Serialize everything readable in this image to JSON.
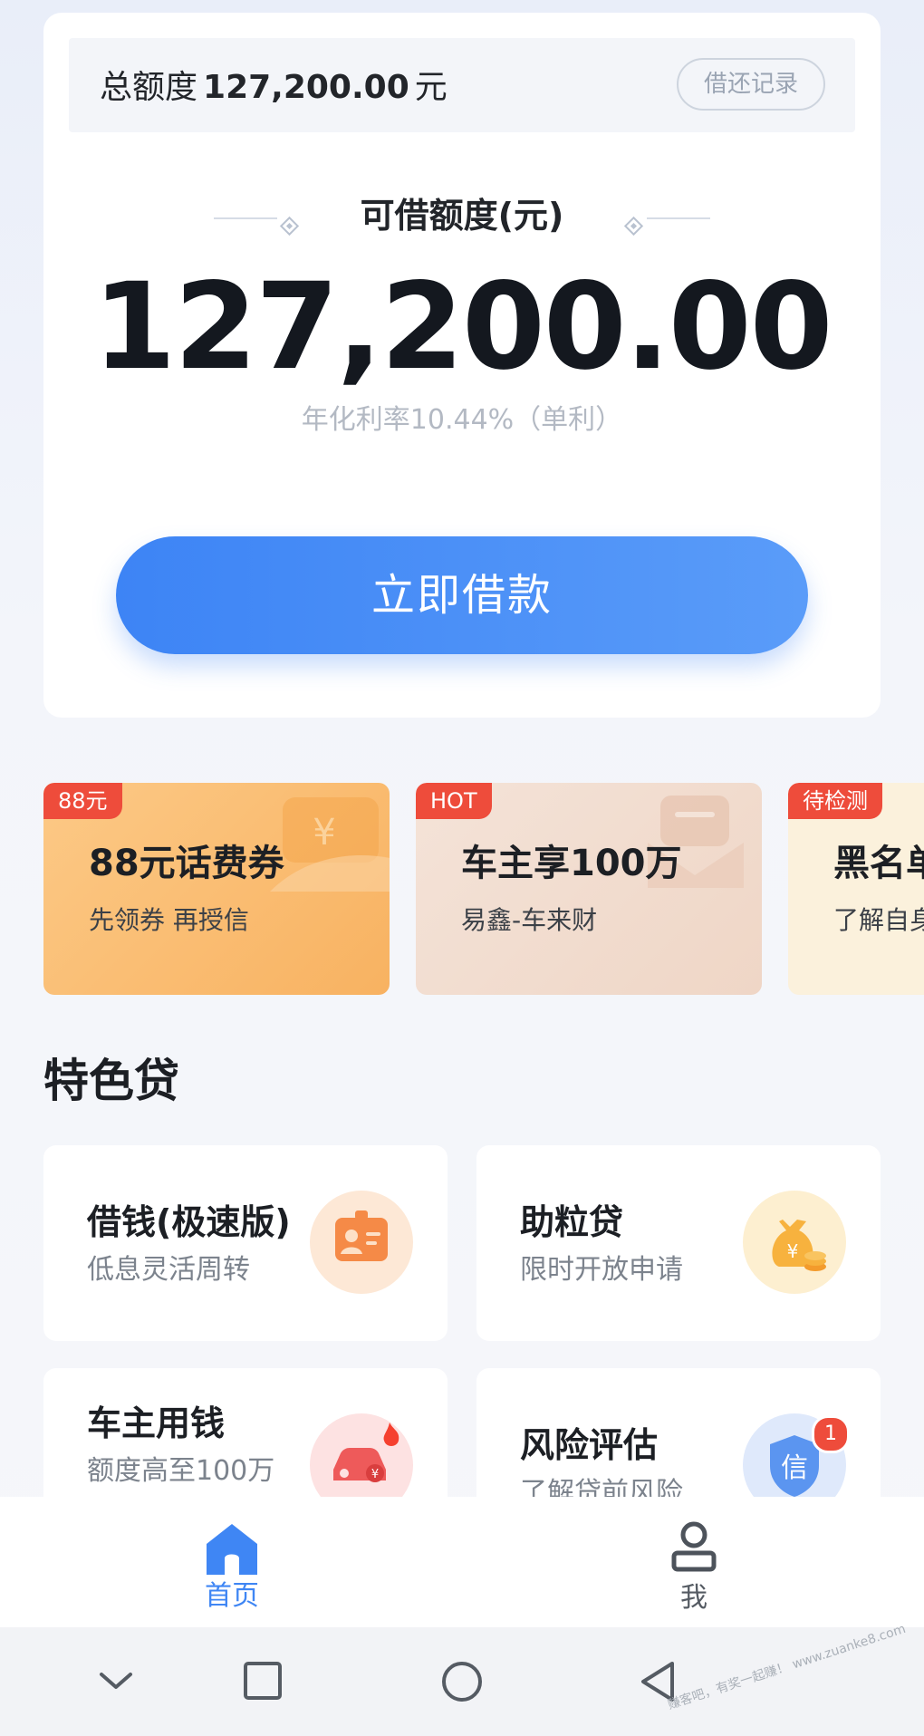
{
  "header": {
    "total_label": "总额度",
    "total_amount": "127,200.00",
    "total_unit": "元",
    "record_button": "借还记录"
  },
  "credit": {
    "available_label": "可借额度(元)",
    "available_amount": "127,200.00",
    "rate_text": "年化利率10.44%（单利）",
    "borrow_button": "立即借款"
  },
  "promos": [
    {
      "tag": "88元",
      "title": "88元话费券",
      "subtitle": "先领券 再授信",
      "bg": "#fbc077"
    },
    {
      "tag": "HOT",
      "title": "车主享100万",
      "subtitle": "易鑫-车来财",
      "bg": "#f2ddd1"
    },
    {
      "tag": "待检测",
      "title": "黑名单",
      "subtitle": "了解自身",
      "bg": "#fbf1dc"
    }
  ],
  "featured": {
    "section_title": "特色贷",
    "items": [
      {
        "title": "借钱(极速版)",
        "subtitle": "低息灵活周转",
        "icon": "id-card-icon"
      },
      {
        "title": "助粒贷",
        "subtitle": "限时开放申请",
        "icon": "money-bag-icon"
      },
      {
        "title": "车主用钱",
        "subtitle": "额度高至100万",
        "icon": "car-fire-icon"
      },
      {
        "title": "风险评估",
        "subtitle": "了解贷前风险",
        "icon": "credit-shield-icon",
        "badge": "1"
      }
    ]
  },
  "tabbar": {
    "tabs": [
      {
        "label": "首页",
        "icon": "home-icon",
        "active": true
      },
      {
        "label": "我",
        "icon": "user-icon",
        "active": false
      }
    ]
  },
  "system_nav": {
    "buttons": [
      "chevron-down-icon",
      "recents-square-icon",
      "home-circle-icon",
      "back-triangle-icon"
    ]
  },
  "watermark": "赚客吧，有奖一起赚！ www.zuanke8.com",
  "colors": {
    "accent": "#3f86f4",
    "badge_red": "#ee4c3b"
  }
}
